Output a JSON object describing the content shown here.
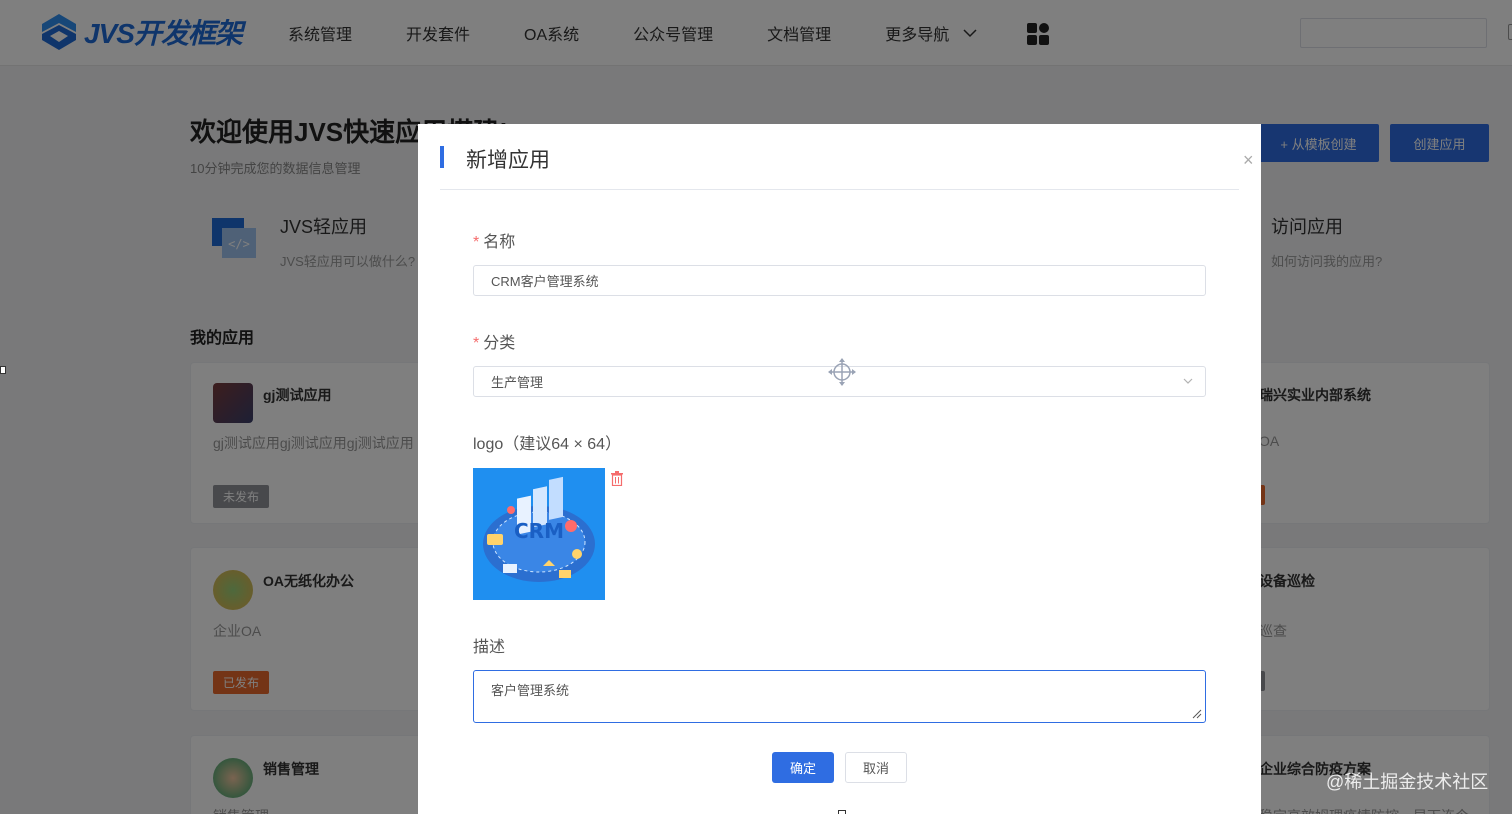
{
  "topbar": {
    "logo_text": "JVS开发框架",
    "nav": [
      "系统管理",
      "开发套件",
      "OA系统",
      "公众号管理",
      "文档管理",
      "更多导航"
    ],
    "icons": {
      "more": "chevron-down-icon",
      "apps": "apps-grid-icon"
    }
  },
  "page": {
    "welcome_title": "欢迎使用JVS快速应用搭建!",
    "welcome_sub": "10分钟完成您的数据信息管理",
    "btn_template": "+ 从模板创建",
    "btn_create": "创建应用",
    "feature1": {
      "title": "JVS轻应用",
      "desc": "JVS轻应用可以做什么?"
    },
    "feature2": {
      "title": "访问应用",
      "desc": "如何访问我的应用?"
    },
    "my_apps": "我的应用",
    "cards": [
      {
        "title": "gj测试应用",
        "desc": "gj测试应用gj测试应用gj测试应用",
        "badge": "未发布"
      },
      {
        "title": "OA无纸化办公",
        "desc": "企业OA",
        "badge": "已发布"
      },
      {
        "title": "销售管理",
        "desc": "销售管理"
      }
    ],
    "right_cards": [
      {
        "title": "瑞兴实业内部系统",
        "desc": "OA"
      },
      {
        "title": "设备巡检",
        "desc": "巡查"
      },
      {
        "title": "企业综合防疫方案",
        "desc": "稳定高效姆理疫情防控，早下连今"
      }
    ]
  },
  "dialog": {
    "title": "新增应用",
    "close": "×",
    "name_label": "名称",
    "name_value": "CRM客户管理系统",
    "category_label": "分类",
    "category_value": "生产管理",
    "logo_label": "logo（建议64 × 64）",
    "logo_image_text": "CRM",
    "desc_label": "描述",
    "desc_value": "客户管理系统",
    "ok": "确定",
    "cancel": "取消",
    "required_mark": "*"
  },
  "watermark": "@稀土掘金技术社区",
  "colors": {
    "primary": "#2f6de2",
    "danger": "#f56c6c",
    "badge_unpublished": "#909399",
    "badge_published": "#e8692c"
  }
}
